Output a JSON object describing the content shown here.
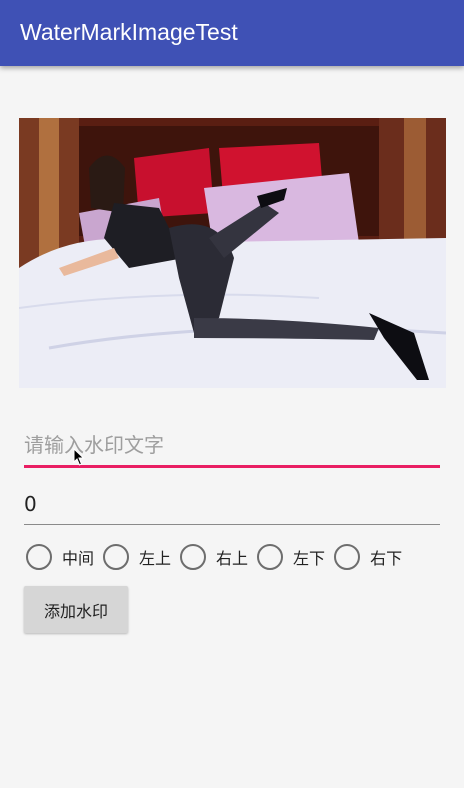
{
  "app": {
    "title": "WaterMarkImageTest"
  },
  "image": {
    "description_icon": "photo-image"
  },
  "watermark_text": {
    "placeholder": "请输入水印文字",
    "value": ""
  },
  "size_field": {
    "value": "0"
  },
  "positions": [
    {
      "label": "中间",
      "checked": false
    },
    {
      "label": "左上",
      "checked": false
    },
    {
      "label": "右上",
      "checked": false
    },
    {
      "label": "左下",
      "checked": false
    },
    {
      "label": "右下",
      "checked": false
    }
  ],
  "add_button": {
    "label": "添加水印"
  },
  "colors": {
    "app_bar": "#3f51b5",
    "accent": "#e91e63",
    "background": "#f5f5f5"
  }
}
